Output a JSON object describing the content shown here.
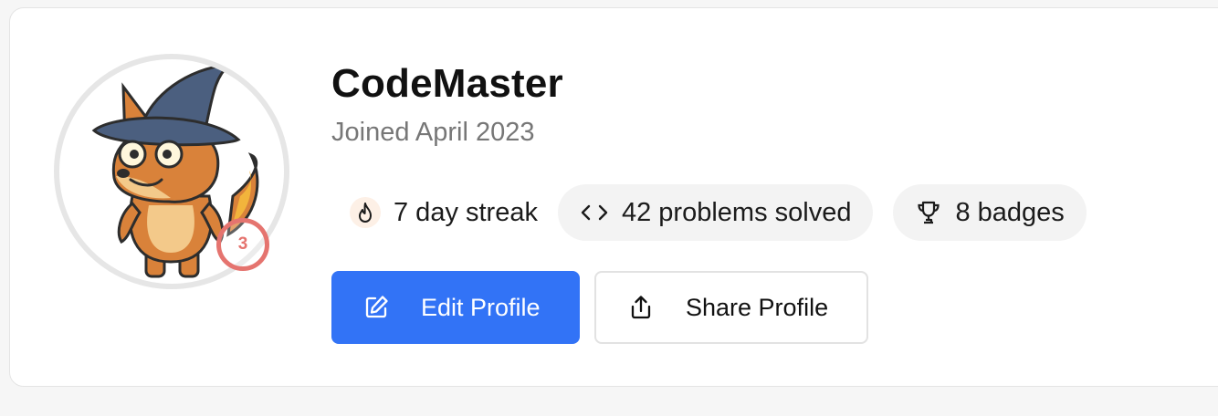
{
  "profile": {
    "username": "CodeMaster",
    "joined": "Joined April 2023",
    "avatar_icon": "fox-wizard-avatar",
    "level": "3",
    "level_color": "#e5746f"
  },
  "stats": [
    {
      "icon": "flame-icon",
      "label": "7 day streak"
    },
    {
      "icon": "code-icon",
      "label": "42 problems solved"
    },
    {
      "icon": "trophy-icon",
      "label": "8 badges"
    }
  ],
  "actions": {
    "edit_label": "Edit Profile",
    "edit_icon": "edit-icon",
    "share_label": "Share Profile",
    "share_icon": "share-icon",
    "primary_color": "#3273f6"
  }
}
